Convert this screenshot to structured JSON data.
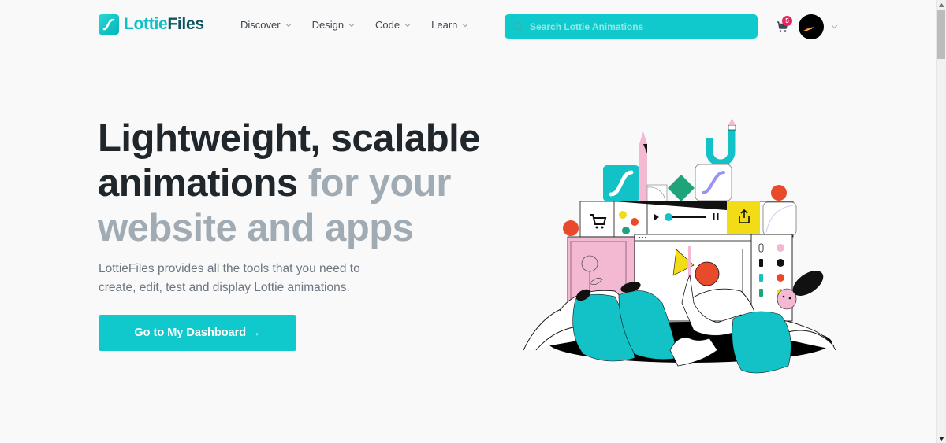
{
  "brand": {
    "name_part1": "Lottie",
    "name_part2": "Files",
    "logo_icon": "lottie-s-curve-icon",
    "primary_color": "#0fc9cc",
    "dark_color": "#0b5561"
  },
  "nav": {
    "items": [
      {
        "label": "Discover",
        "icon": "chevron-down-icon"
      },
      {
        "label": "Design",
        "icon": "chevron-down-icon"
      },
      {
        "label": "Code",
        "icon": "chevron-down-icon"
      },
      {
        "label": "Learn",
        "icon": "chevron-down-icon"
      }
    ]
  },
  "search": {
    "placeholder": "Search Lottie Animations",
    "value": "",
    "icon": "search-icon"
  },
  "cart": {
    "icon": "cart-icon",
    "count": "5",
    "badge_color": "#e7265f"
  },
  "user": {
    "avatar_icon": "avatar",
    "menu_icon": "chevron-down-icon"
  },
  "hero": {
    "title_dark": "Lightweight, scalable animations",
    "title_muted": " for your website and apps",
    "subtitle": "LottieFiles provides all the tools that you need to create, edit, test and display Lottie animations.",
    "cta_label": "Go to My Dashboard →"
  },
  "illustration": {
    "description": "Character lying in a portal surrounded by design tool blocks"
  }
}
